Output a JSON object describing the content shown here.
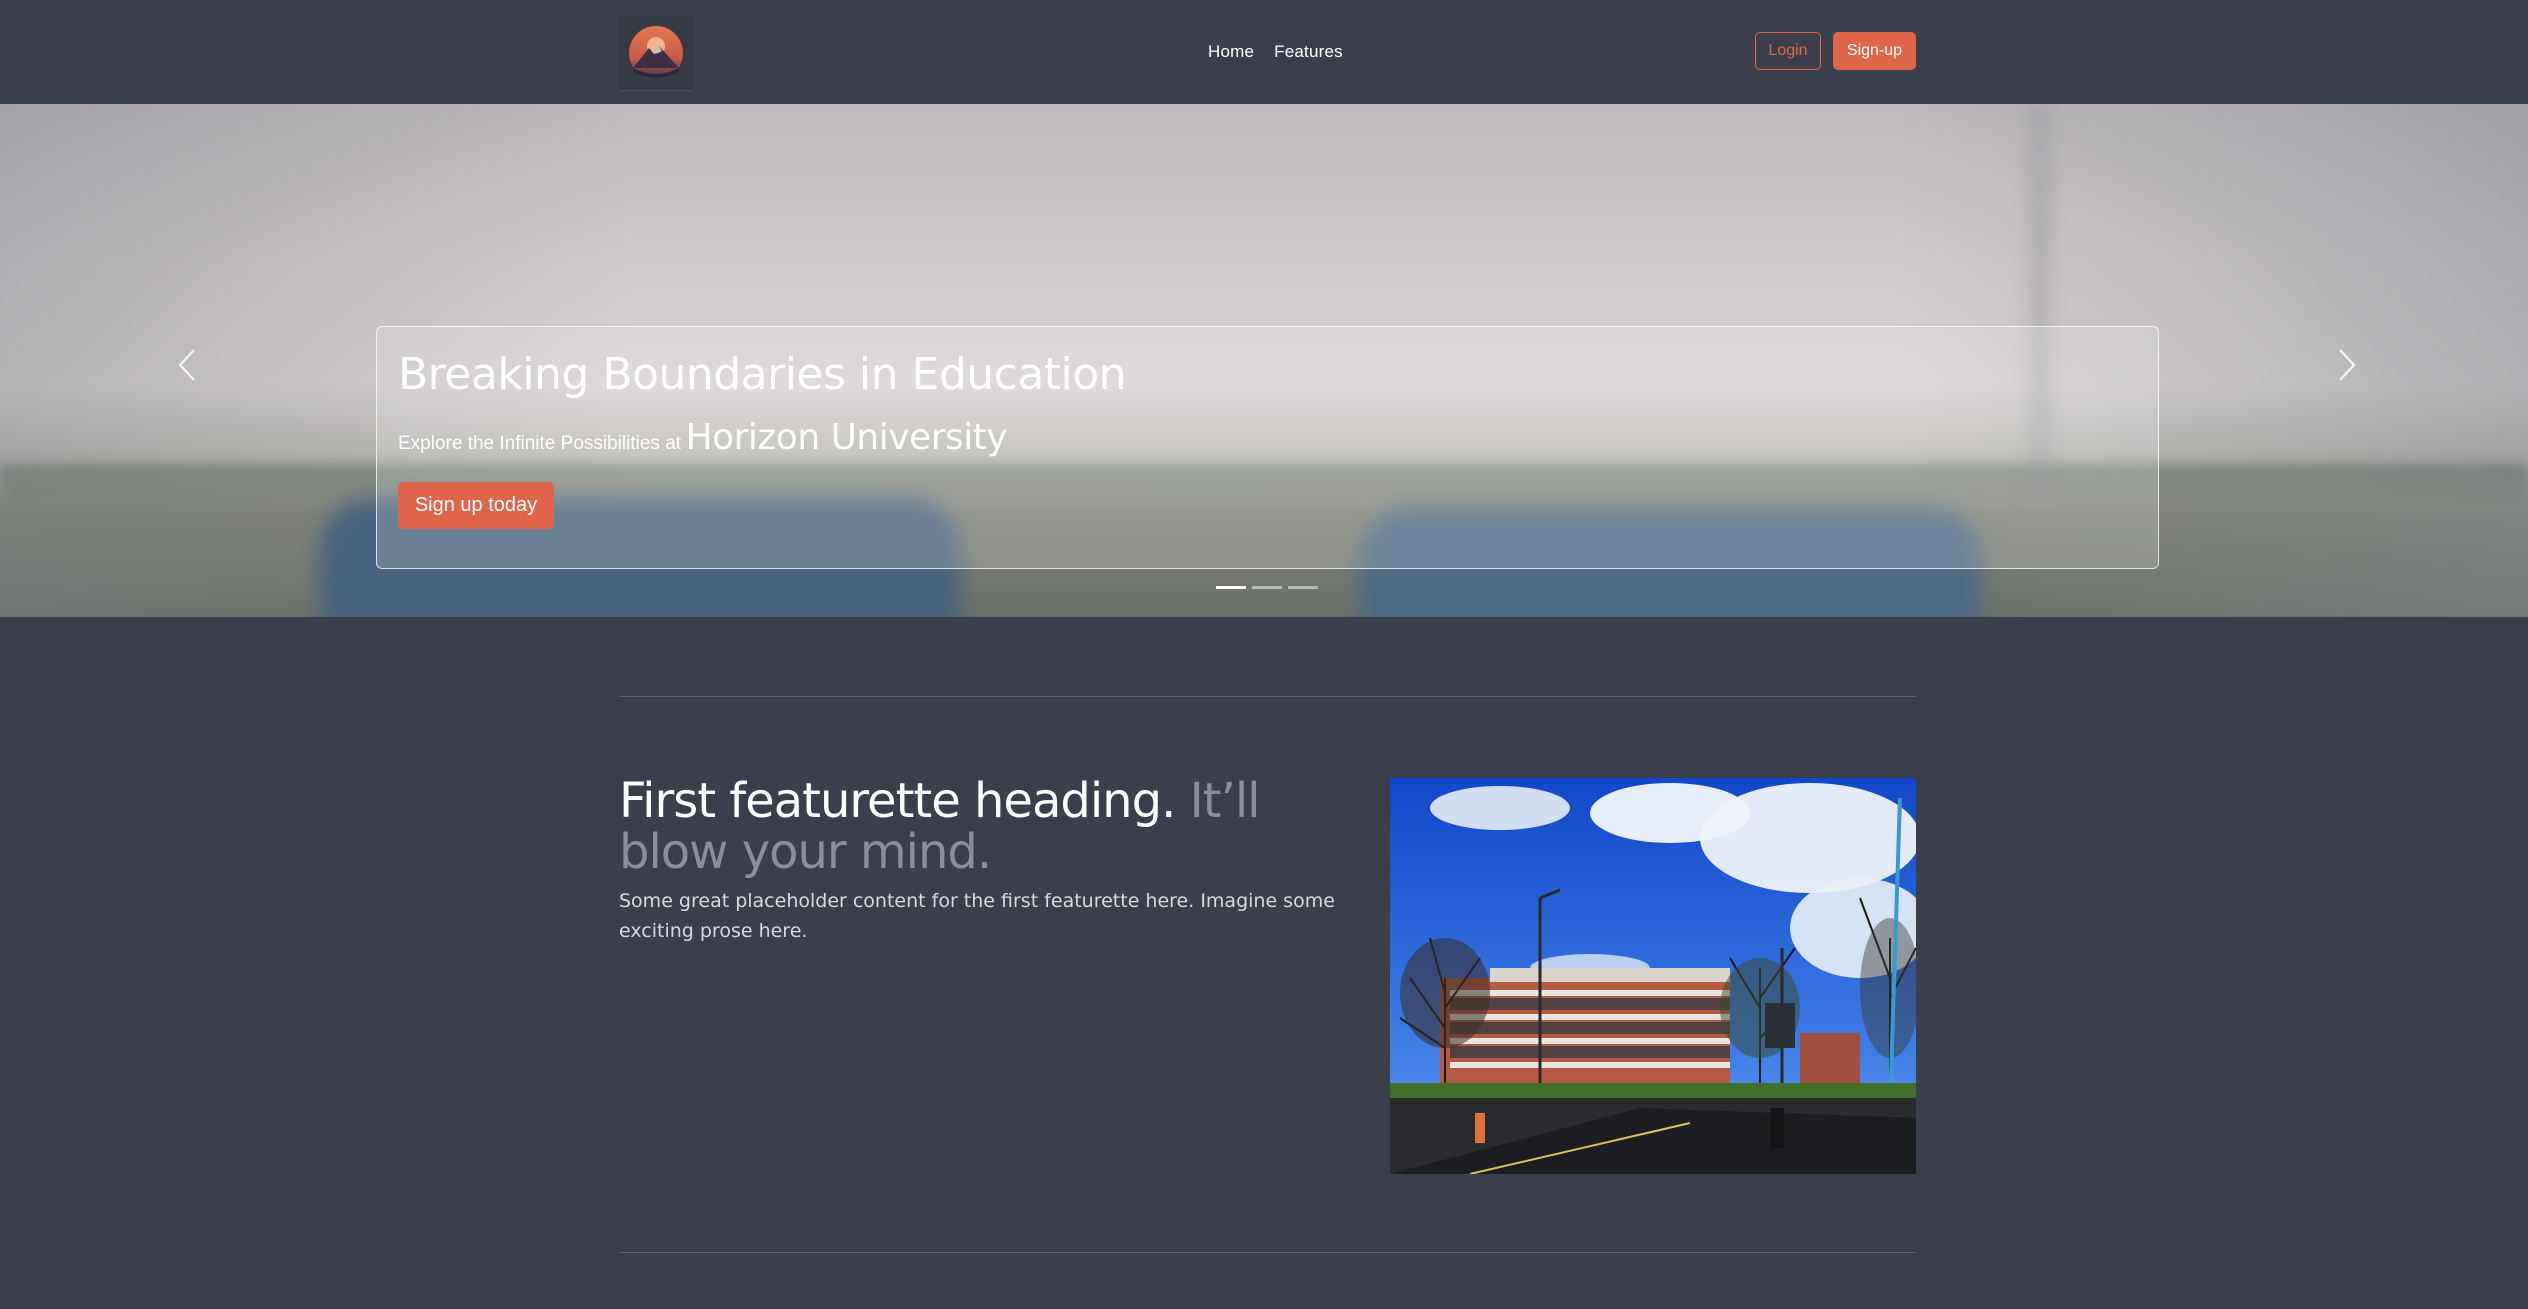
{
  "nav": {
    "links": [
      "Home",
      "Features"
    ],
    "login_label": "Login",
    "signup_label": "Sign-up"
  },
  "hero": {
    "title": "Breaking Boundaries in Education",
    "subtitle_small": "Explore the Infinite Possibilities at",
    "subtitle_big": "Horizon University",
    "cta_label": "Sign up today",
    "slides_count": 3,
    "active_slide": 1
  },
  "featurette": {
    "heading": "First featurette heading.",
    "heading_muted": "It’ll blow your mind.",
    "text": "Some great placeholder content for the first featurette here. Imagine some exciting prose here."
  },
  "colors": {
    "background": "#3a3f4b",
    "accent": "#e0664b"
  },
  "icons": {
    "logo": "mountain-sunset-logo",
    "prev": "chevron-left-icon",
    "next": "chevron-right-icon"
  }
}
